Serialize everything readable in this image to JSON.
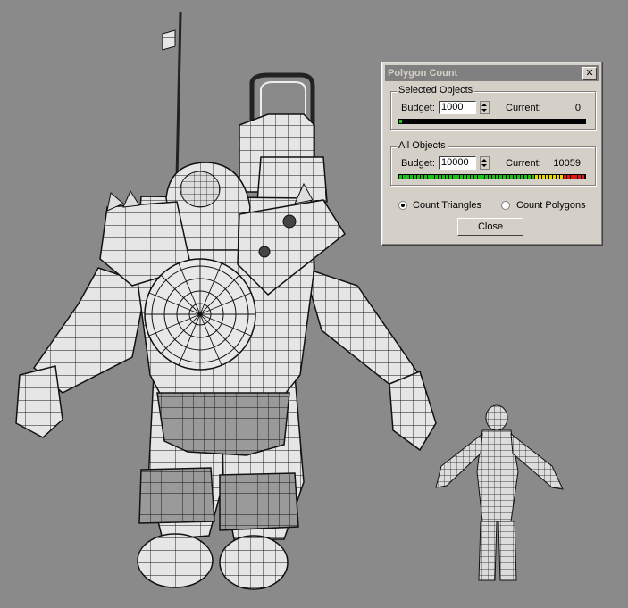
{
  "dialog": {
    "title": "Polygon Count",
    "close_icon": "close-icon",
    "selected_objects": {
      "legend": "Selected Objects",
      "budget_label": "Budget:",
      "budget_value": "1000",
      "current_label": "Current:",
      "current_value": "0",
      "usage_fraction": 0.0
    },
    "all_objects": {
      "legend": "All Objects",
      "budget_label": "Budget:",
      "budget_value": "10000",
      "current_label": "Current:",
      "current_value": "10059",
      "usage_fraction": 1.0059
    },
    "count_options": {
      "triangles_label": "Count Triangles",
      "polygons_label": "Count Polygons",
      "selected": "triangles"
    },
    "close_label": "Close"
  },
  "colors": {
    "viewport_bg": "#8a8a8a",
    "meter_green": "#18c018",
    "meter_yellow": "#e8d800",
    "meter_red": "#e01818"
  },
  "viewport": {
    "objects": [
      "armored-character-wireframe",
      "humanoid-character-wireframe"
    ]
  }
}
